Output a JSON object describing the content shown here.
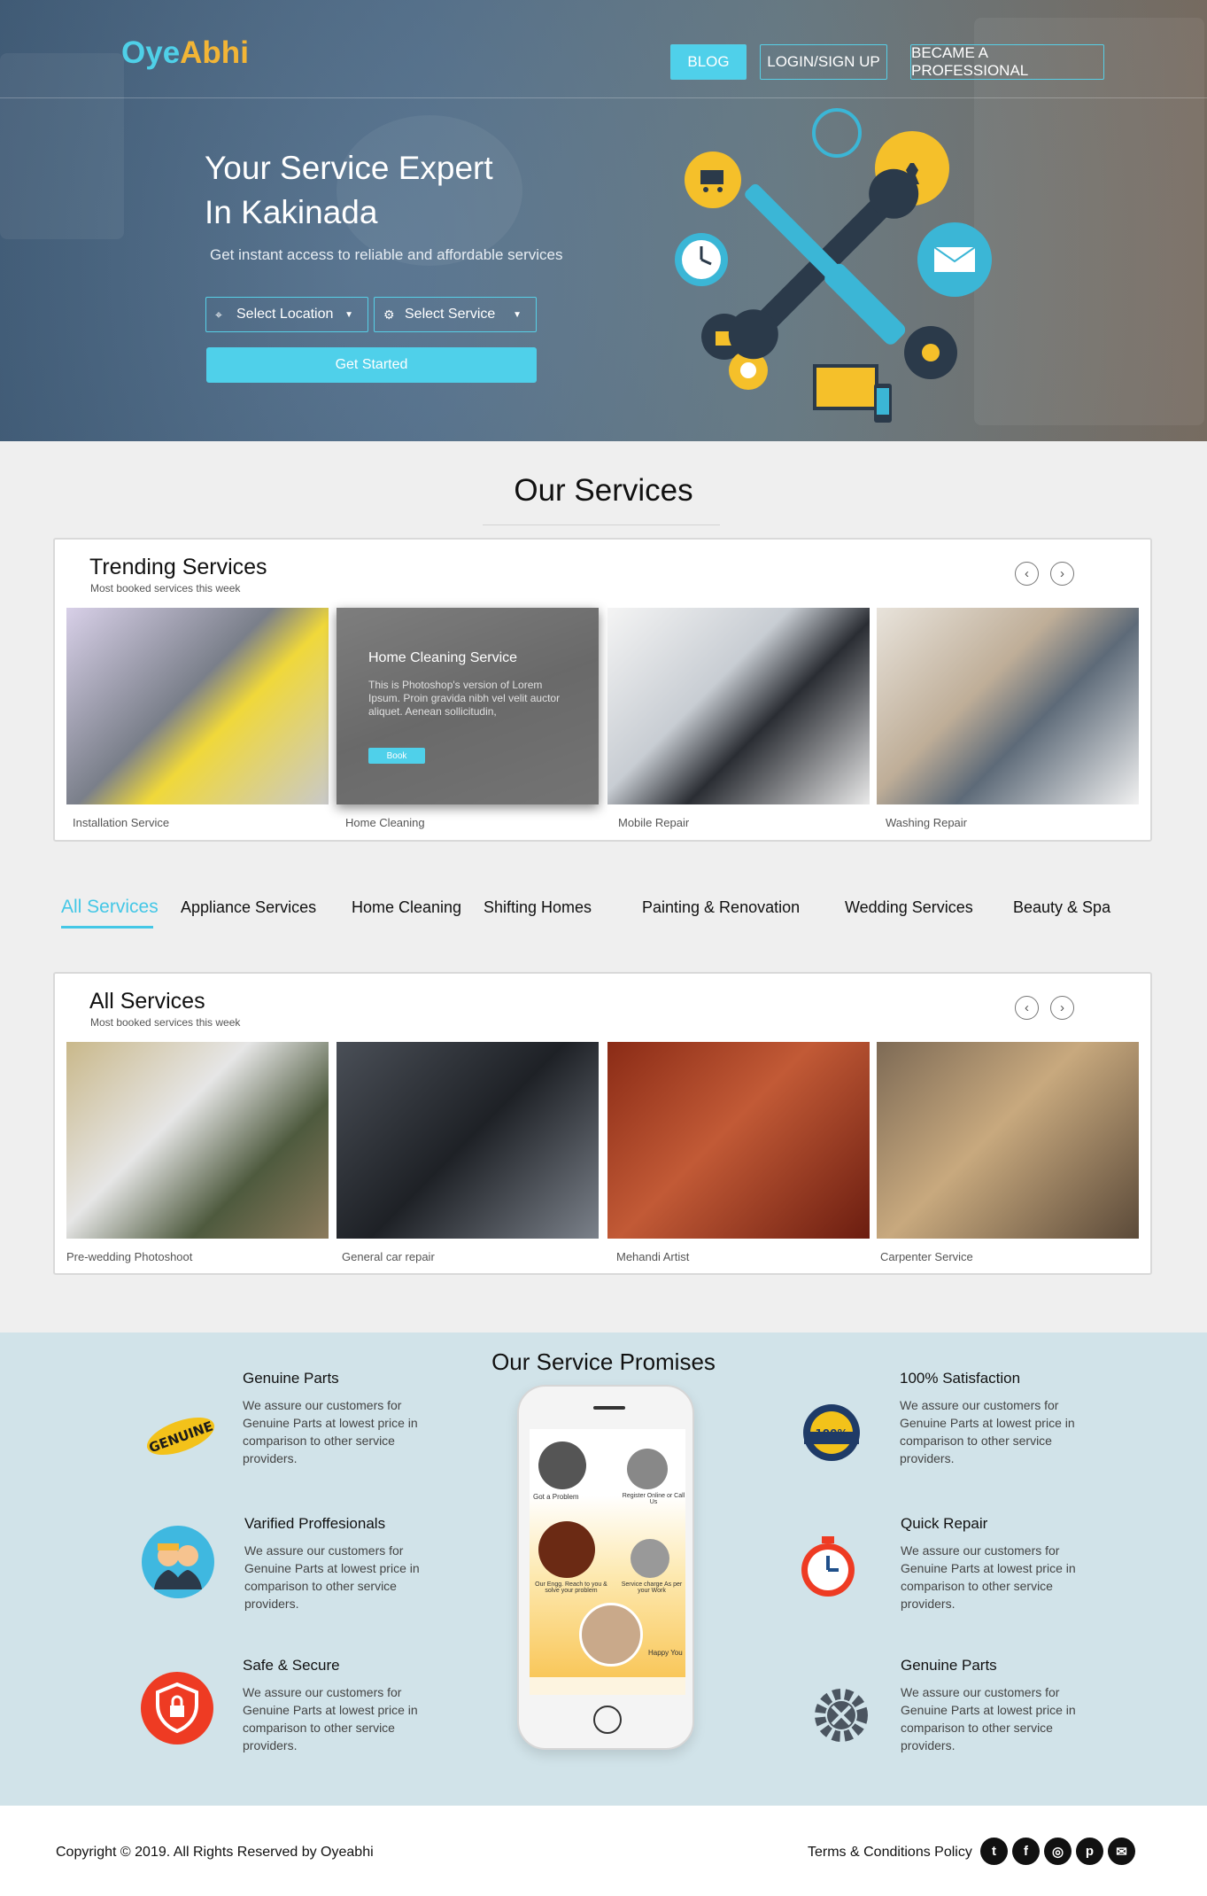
{
  "brand": {
    "logo_part1": "Oye",
    "logo_part2": "Abhi"
  },
  "nav": {
    "blog": "BLOG",
    "login": "LOGIN/SIGN UP",
    "professional": "BECAME A PROFESSIONAL"
  },
  "hero": {
    "title_line1": "Your Service Expert",
    "title_line2": "In Kakinada",
    "subtitle": "Get instant access to reliable and affordable services",
    "location_select": "Select Location",
    "service_select": "Select Service",
    "cta": "Get Started"
  },
  "services": {
    "title": "Our Services",
    "trending": {
      "heading": "Trending Services",
      "subheading": "Most booked services this week",
      "cards": [
        {
          "label": "Installation Service"
        },
        {
          "label": "Home Cleaning",
          "overlay_title": "Home Cleaning Service",
          "overlay_text": "This is Photoshop's version  of Lorem Ipsum. Proin gravida nibh vel velit auctor aliquet. Aenean sollicitudin,",
          "overlay_button": "Book"
        },
        {
          "label": "Mobile Repair"
        },
        {
          "label": "Washing Repair"
        }
      ]
    },
    "tabs": [
      "All Services",
      "Appliance Services",
      "Home Cleaning",
      "Shifting Homes",
      "Painting & Renovation",
      "Wedding Services",
      "Beauty & Spa"
    ],
    "all": {
      "heading": "All Services",
      "subheading": "Most booked services this week",
      "cards": [
        {
          "label": "Pre-wedding Photoshoot"
        },
        {
          "label": "General car repair"
        },
        {
          "label": "Mehandi Artist"
        },
        {
          "label": "Carpenter Service"
        }
      ]
    }
  },
  "promises": {
    "title": "Our Service Promises",
    "items": [
      {
        "title": "Genuine Parts",
        "text": "We assure our customers for Genuine Parts at lowest price in comparison to other service providers.",
        "icon": "genuine-badge-icon"
      },
      {
        "title": "Varified Proffesionals",
        "text": "We assure our customers for Genuine Parts at lowest price in comparison to other service providers.",
        "icon": "professionals-icon"
      },
      {
        "title": "Safe & Secure",
        "text": "We assure our customers for Genuine Parts at lowest price in comparison to other service providers.",
        "icon": "shield-lock-icon"
      },
      {
        "title": "100% Satisfaction",
        "text": "We assure our customers for Genuine Parts at lowest price in comparison to other service providers.",
        "icon": "satisfaction-badge-icon"
      },
      {
        "title": "Quick Repair",
        "text": "We assure our customers for Genuine Parts at lowest price in comparison to other service providers.",
        "icon": "stopwatch-icon"
      },
      {
        "title": "Genuine Parts",
        "text": "We assure our customers for Genuine Parts at lowest price in comparison to other service providers.",
        "icon": "gear-tools-icon"
      }
    ],
    "genuine_badge_text": "GENUINE",
    "satisfaction_badge_text": "100%",
    "phone_steps": [
      "Got a Problem",
      "Register Online or Call Us",
      "Our Engg. Reach to you & solve your problem",
      "Service charge As per your Work",
      "Happy You"
    ]
  },
  "footer": {
    "copyright": "Copyright © 2019. All Rights Reserved by Oyeabhi",
    "terms": "Terms & Conditions Policy",
    "social": [
      "twitter-icon",
      "facebook-icon",
      "instagram-icon",
      "pinterest-icon",
      "mail-icon"
    ]
  },
  "colors": {
    "accent": "#4fd0ea",
    "logo_yellow": "#f3b536",
    "promise_bg": "#d1e3e9"
  }
}
